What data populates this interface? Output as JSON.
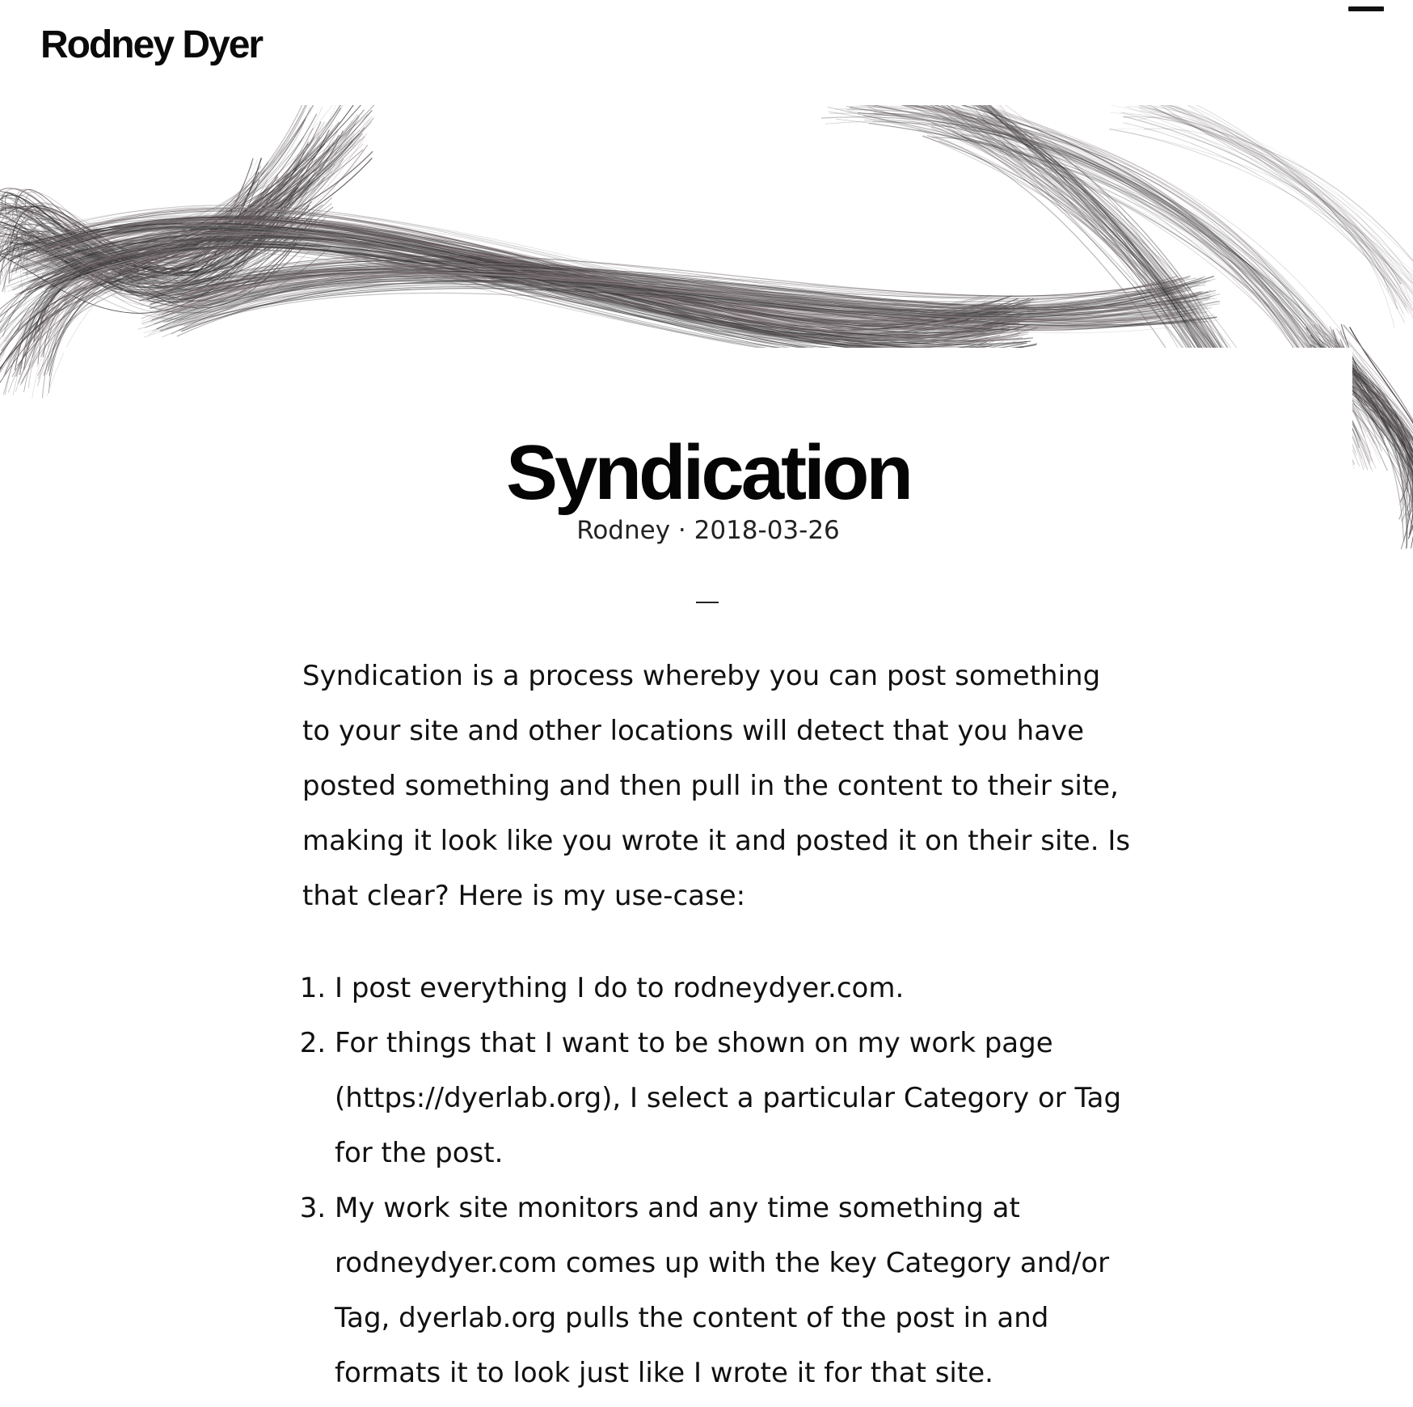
{
  "header": {
    "site_title": "Rodney Dyer",
    "menu_icon": "hamburger-menu-icon"
  },
  "hero": {
    "image_description": "abstract-gray-line-art-banner"
  },
  "post": {
    "title": "Syndication",
    "author": "Rodney",
    "separator": "·",
    "date": "2018-03-26",
    "intro": "Syndication is a process whereby you can post something to your site and other locations will detect that you have posted something and then pull in the content to their site, making it look like you wrote it and posted it on their site.  Is that clear? Here is my use-case:",
    "list_items": [
      "I post everything I do to rodneydyer.com.",
      "For things that I want to be shown on my work page (https://dyerlab.org), I select a particular Category or Tag for the post.",
      "My work site monitors and any time something at rodneydyer.com comes up with the key Category and/or Tag, dyerlab.org pulls the content of the post in and formats it to look just like I wrote it for that site."
    ]
  },
  "colors": {
    "text": "#111111",
    "background": "#ffffff",
    "hero_lines": "#5a5255"
  }
}
